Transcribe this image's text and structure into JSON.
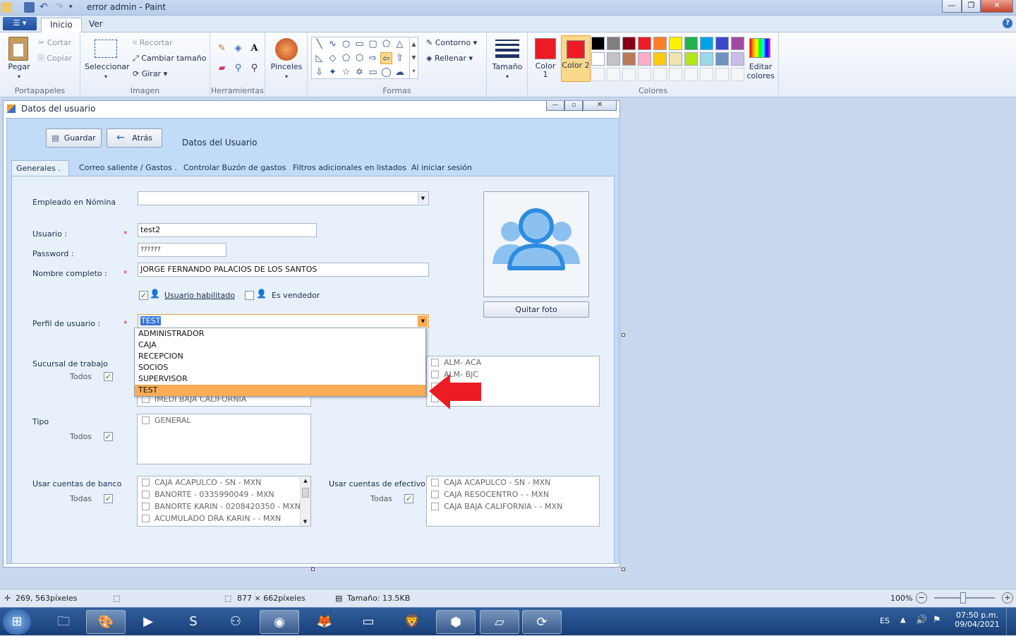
{
  "app": {
    "window_title": "error admin - Paint",
    "tabs": [
      "Inicio",
      "Ver"
    ],
    "active_tab": "Inicio",
    "groups": {
      "portapapeles": "Portapapeles",
      "imagen": "Imagen",
      "herramientas": "Herramientas",
      "formas": "Formas",
      "colores": "Colores"
    },
    "buttons": {
      "pegar": "Pegar",
      "cortar": "Cortar",
      "copiar": "Copiar",
      "seleccionar": "Seleccionar",
      "recortar": "Recortar",
      "cambiar_tamano": "Cambiar tamaño",
      "girar": "Girar",
      "pinceles": "Pinceles",
      "contorno": "Contorno",
      "rellenar": "Rellenar",
      "tamano": "Tamaño",
      "color1": "Color 1",
      "color2": "Color 2",
      "editar_colores": "Editar colores"
    },
    "colors": {
      "color1": "#ed1c24",
      "color2": "#ed1c24",
      "palette_row1": [
        "#000000",
        "#7f7f7f",
        "#880015",
        "#ed1c24",
        "#ff7f27",
        "#fff200",
        "#22b14c",
        "#00a2e8",
        "#3f48cc",
        "#a349a4"
      ],
      "palette_row2": [
        "#ffffff",
        "#c3c3c3",
        "#b97a57",
        "#ffaec9",
        "#ffc90e",
        "#efe4b0",
        "#b5e61d",
        "#99d9ea",
        "#7092be",
        "#c8bfe7"
      ]
    }
  },
  "dialog": {
    "title": "Datos del usuario",
    "heading": "Datos del Usuario",
    "save_button": "Guardar",
    "back_button": "Atrás",
    "tabs": [
      "Generales",
      "Correo saliente / Gastos",
      "Controlar Buzón de gastos",
      "Filtros adicionales en listados",
      "Al iniciar sesión"
    ],
    "form": {
      "empleado_label": "Empleado en Nómina",
      "usuario_label": "Usuario :",
      "usuario_value": "test2",
      "password_label": "Password :",
      "password_value": "??????",
      "nombre_label": "Nombre completo :",
      "nombre_value": "JORGE FERNANDO PALACIOS DE LOS SANTOS",
      "habilitado_label": "Usuario habilitado",
      "vendedor_label": "Es vendedor",
      "perfil_label": "Perfil de usuario :",
      "perfil_value": "TEST",
      "required_mark": "*",
      "quitar_foto": "Quitar foto"
    },
    "perfil_options": [
      "ADMINISTRADOR",
      "CAJA",
      "RECEPCION",
      "SOCIOS",
      "SUPERVISOR",
      "TEST"
    ],
    "sucursal": {
      "label": "Sucursal de trabajo",
      "todos": "Todos",
      "hidden_item": "IMEDI BAJA CALIFORNIA",
      "almacen_items": [
        "ALM- ACA",
        "ALM- BJC"
      ]
    },
    "tipo": {
      "label": "Tipo",
      "todos": "Todos",
      "items": [
        "GENERAL"
      ]
    },
    "bancos": {
      "label": "Usar cuentas de banco",
      "todas": "Todas",
      "items": [
        "CAJA ACAPULCO - SN - MXN",
        "BANORTE - 0335990049 - MXN",
        "BANORTE KARIN - 0208420350 - MXN",
        "ACUMULADO DRA KARIN -  - MXN"
      ]
    },
    "efectivo": {
      "label": "Usar cuentas de efectivo",
      "todas": "Todas",
      "items": [
        "CAJA ACAPULCO - SN - MXN",
        "CAJA RESOCENTRO -  - MXN",
        "CAJA BAJA CALIFORNIA -  - MXN"
      ]
    }
  },
  "status": {
    "cursor": "269, 563píxeles",
    "dimensions": "877 × 662píxeles",
    "size": "Tamaño: 13.5KB",
    "zoom": "100%"
  },
  "taskbar": {
    "lang": "ES",
    "time": "07:50 p.m.",
    "date": "09/04/2021"
  }
}
